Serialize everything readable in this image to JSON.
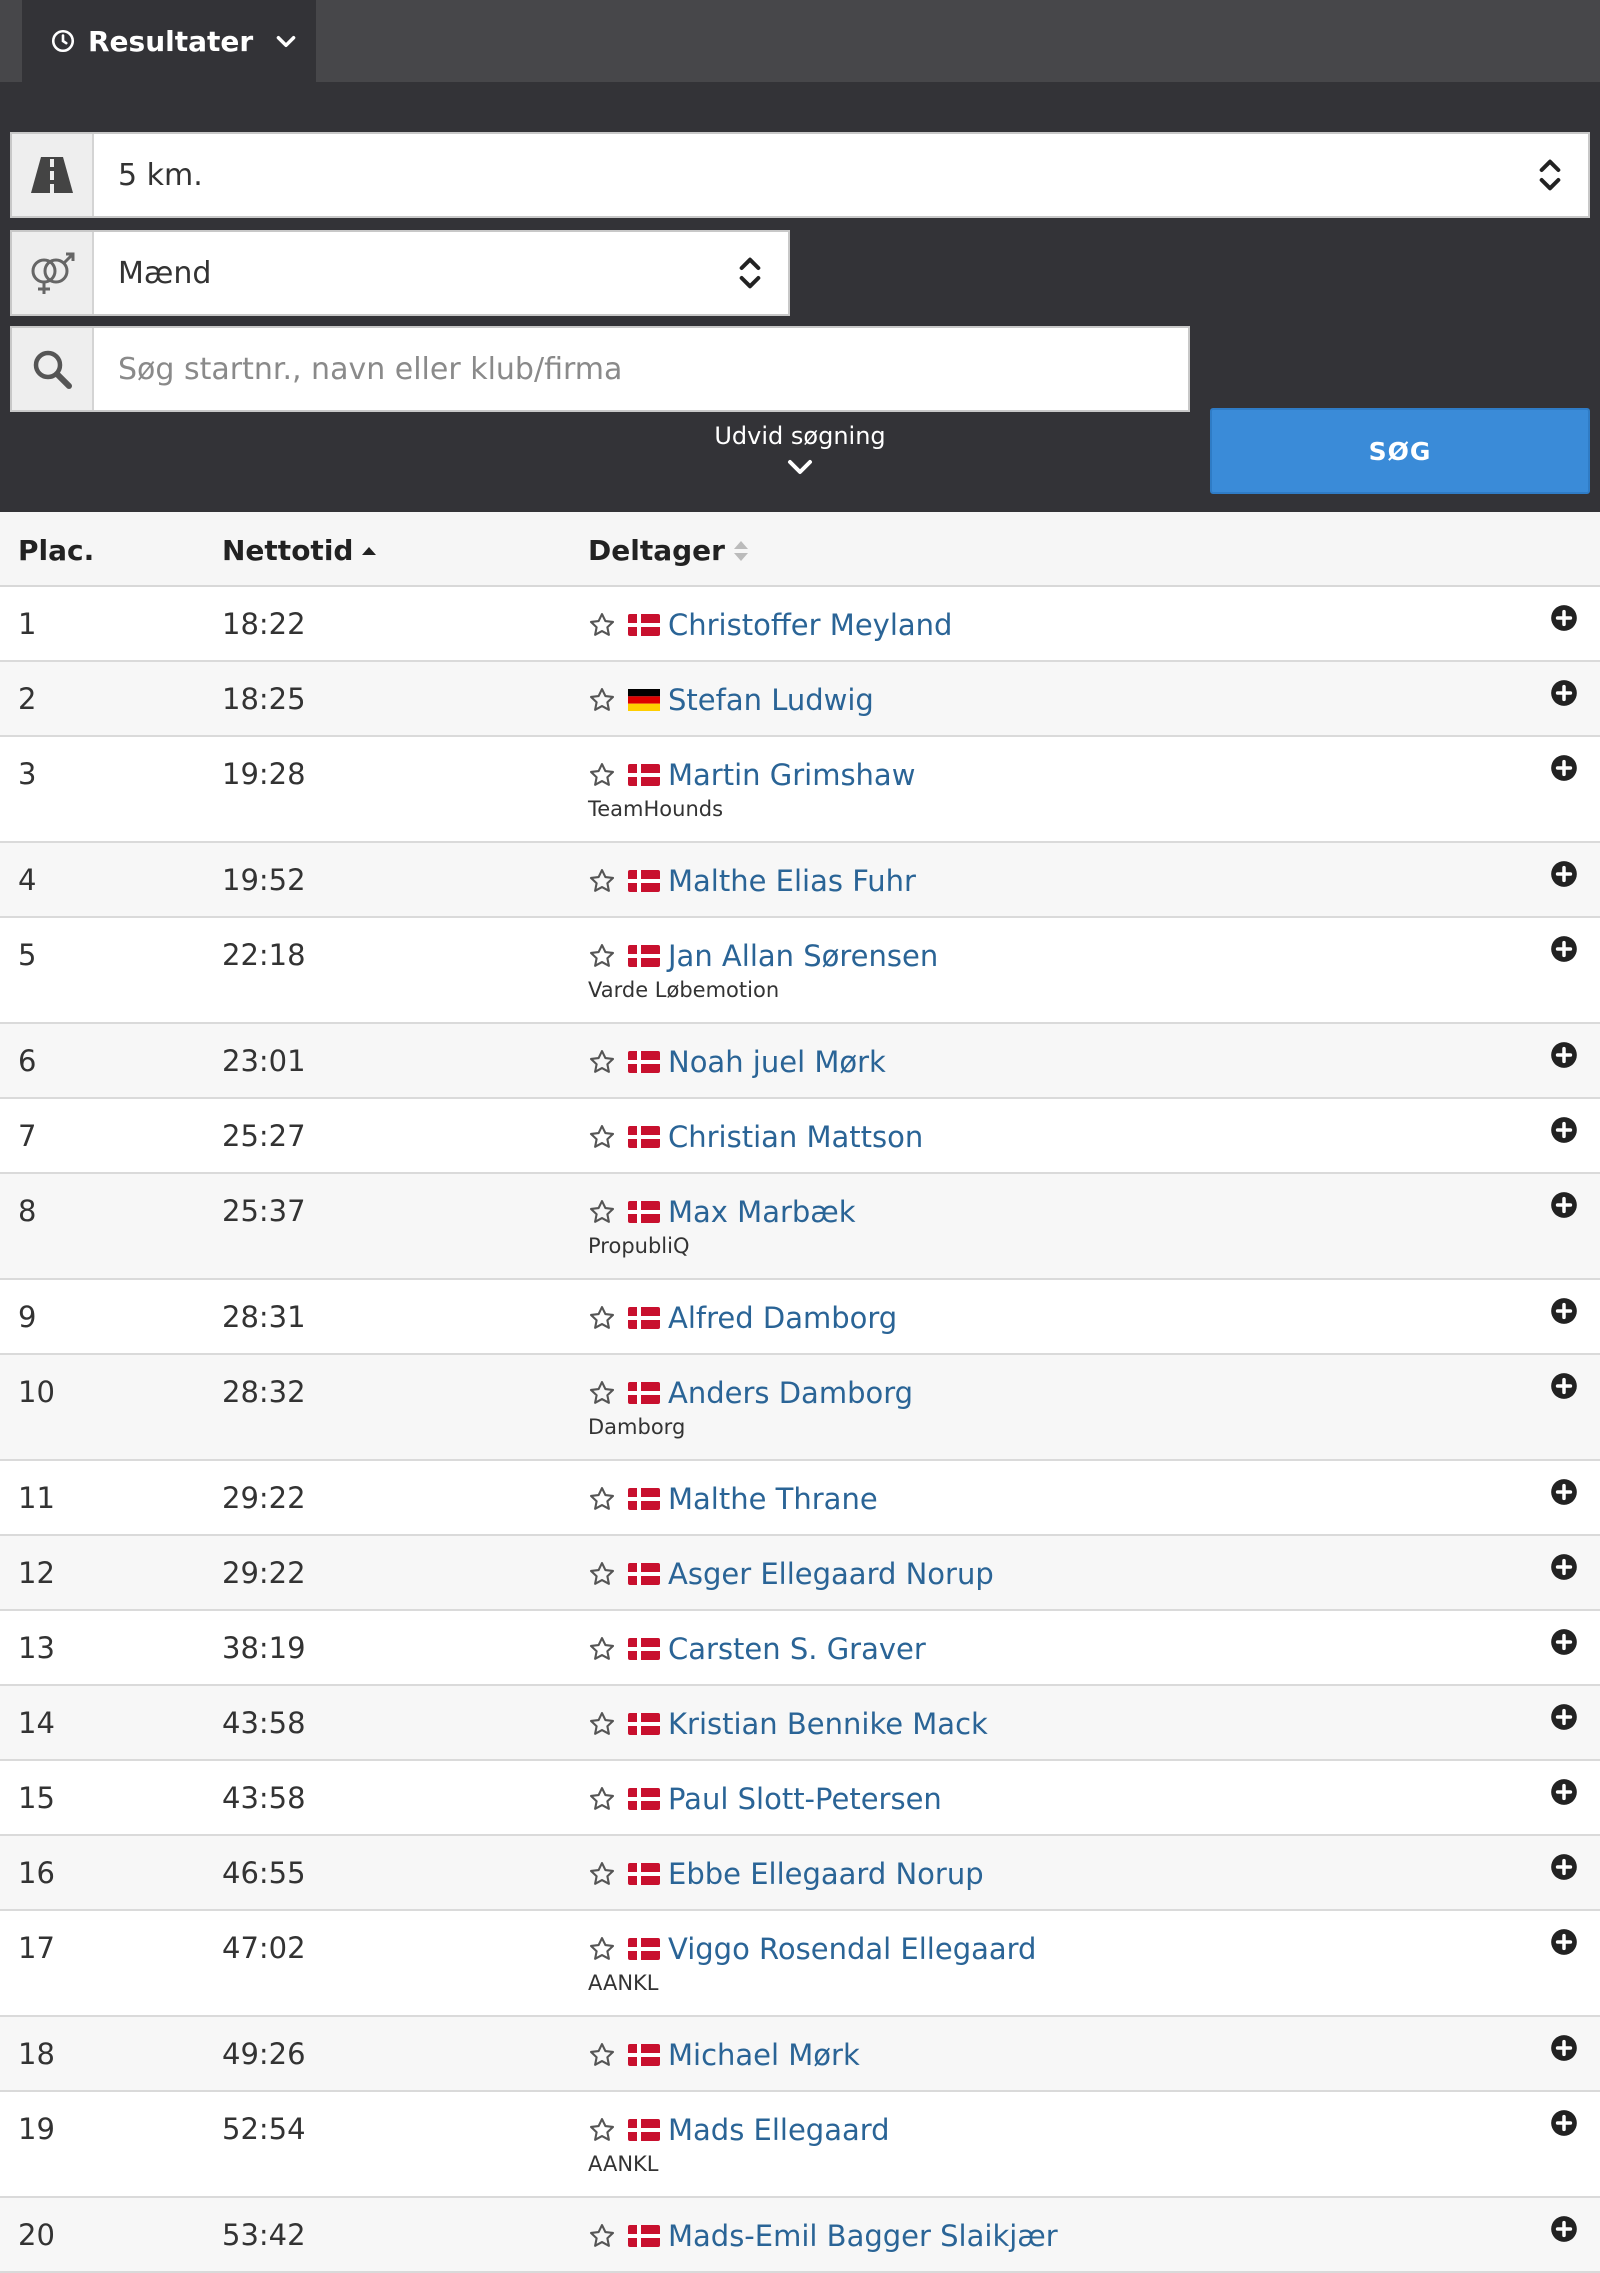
{
  "tab": {
    "label": "Resultater",
    "icon": "clock-icon"
  },
  "filters": {
    "distance": {
      "value": "5 km.",
      "icon": "road-icon"
    },
    "gender": {
      "value": "Mænd",
      "icon": "gender-icon"
    },
    "search": {
      "placeholder": "Søg startnr., navn eller klub/firma",
      "icon": "search-icon"
    },
    "search_button": "SØG",
    "expand_label": "Udvid søgning"
  },
  "table": {
    "headers": {
      "place": "Plac.",
      "time": "Nettotid",
      "participant": "Deltager"
    },
    "rows": [
      {
        "place": "1",
        "time": "18:22",
        "name": "Christoffer Meyland",
        "club": "",
        "flag": "DK"
      },
      {
        "place": "2",
        "time": "18:25",
        "name": "Stefan Ludwig",
        "club": "",
        "flag": "DE"
      },
      {
        "place": "3",
        "time": "19:28",
        "name": "Martin Grimshaw",
        "club": "TeamHounds",
        "flag": "DK"
      },
      {
        "place": "4",
        "time": "19:52",
        "name": "Malthe Elias Fuhr",
        "club": "",
        "flag": "DK"
      },
      {
        "place": "5",
        "time": "22:18",
        "name": "Jan Allan Sørensen",
        "club": "Varde Løbemotion",
        "flag": "DK"
      },
      {
        "place": "6",
        "time": "23:01",
        "name": "Noah juel Mørk",
        "club": "",
        "flag": "DK"
      },
      {
        "place": "7",
        "time": "25:27",
        "name": "Christian Mattson",
        "club": "",
        "flag": "DK"
      },
      {
        "place": "8",
        "time": "25:37",
        "name": "Max Marbæk",
        "club": "PropubliQ",
        "flag": "DK"
      },
      {
        "place": "9",
        "time": "28:31",
        "name": "Alfred Damborg",
        "club": "",
        "flag": "DK"
      },
      {
        "place": "10",
        "time": "28:32",
        "name": "Anders Damborg",
        "club": "Damborg",
        "flag": "DK"
      },
      {
        "place": "11",
        "time": "29:22",
        "name": "Malthe Thrane",
        "club": "",
        "flag": "DK"
      },
      {
        "place": "12",
        "time": "29:22",
        "name": "Asger Ellegaard Norup",
        "club": "",
        "flag": "DK"
      },
      {
        "place": "13",
        "time": "38:19",
        "name": "Carsten S. Graver",
        "club": "",
        "flag": "DK"
      },
      {
        "place": "14",
        "time": "43:58",
        "name": "Kristian Bennike Mack",
        "club": "",
        "flag": "DK"
      },
      {
        "place": "15",
        "time": "43:58",
        "name": "Paul Slott-Petersen",
        "club": "",
        "flag": "DK"
      },
      {
        "place": "16",
        "time": "46:55",
        "name": "Ebbe Ellegaard Norup",
        "club": "",
        "flag": "DK"
      },
      {
        "place": "17",
        "time": "47:02",
        "name": "Viggo Rosendal Ellegaard",
        "club": "AANKL",
        "flag": "DK"
      },
      {
        "place": "18",
        "time": "49:26",
        "name": "Michael Mørk",
        "club": "",
        "flag": "DK"
      },
      {
        "place": "19",
        "time": "52:54",
        "name": "Mads Ellegaard",
        "club": "AANKL",
        "flag": "DK"
      },
      {
        "place": "20",
        "time": "53:42",
        "name": "Mads-Emil Bagger Slaikjær",
        "club": "",
        "flag": "DK"
      }
    ]
  },
  "colors": {
    "header_bar": "#47474a",
    "filter_panel": "#333337",
    "search_button": "#3a8bd8",
    "link": "#2a6496"
  }
}
